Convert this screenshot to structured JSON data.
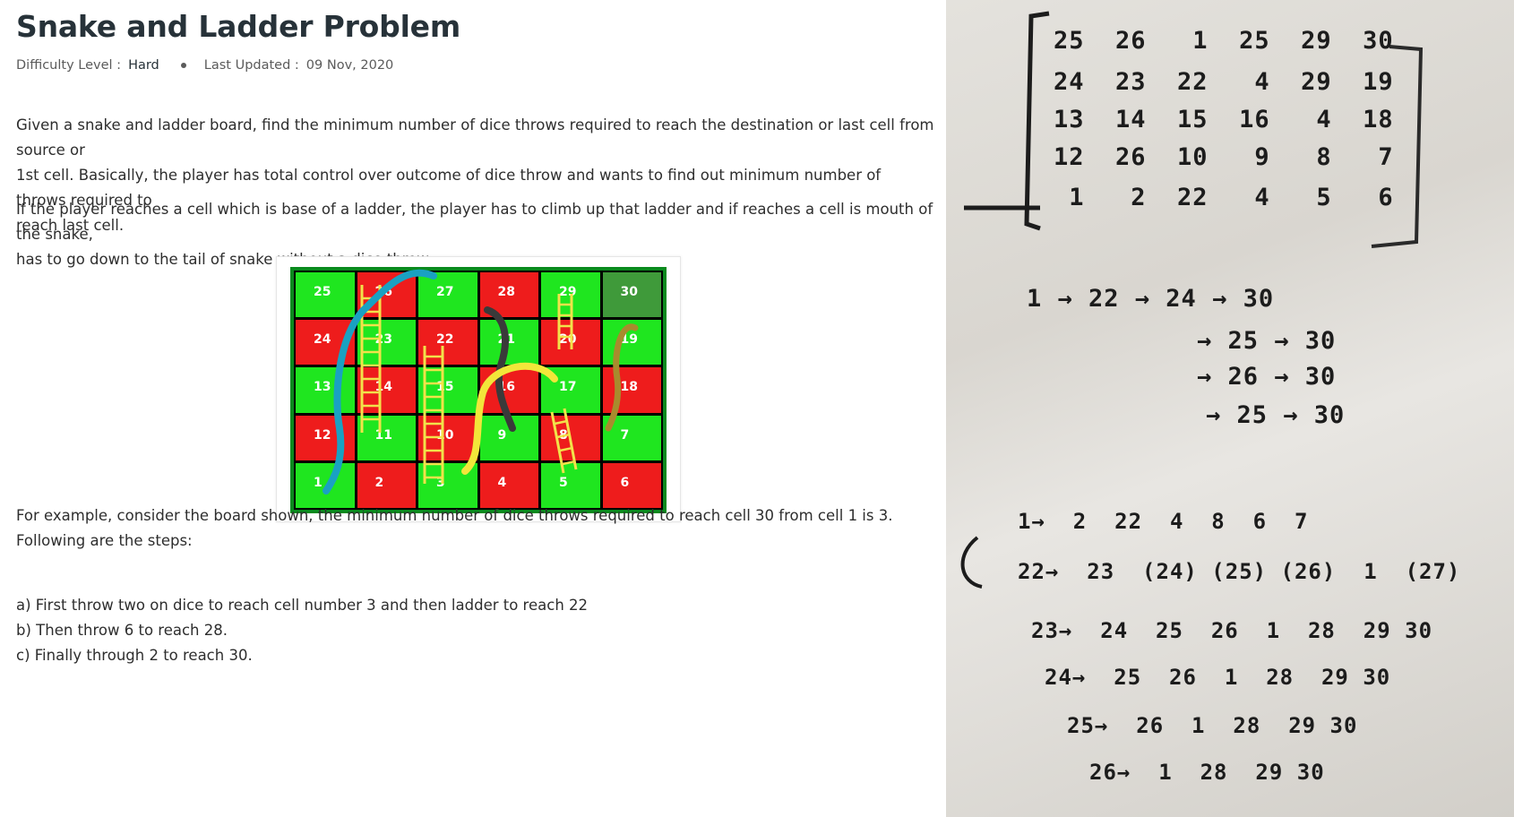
{
  "article": {
    "title": "Snake and Ladder Problem",
    "difficulty_label": "Difficulty Level :",
    "difficulty_value": "Hard",
    "updated_label": "Last Updated :",
    "updated_value": "09 Nov, 2020",
    "para1_line1": "Given a snake and ladder board, find the minimum number of dice throws required to reach the destination or last cell from source or",
    "para1_line2": "1st cell. Basically, the player has total control over outcome of dice throw and wants to find out minimum number of throws required to",
    "para1_line3": "reach last cell.",
    "para2_line1": "If the player reaches a cell which is base of a ladder, the player has to climb up that ladder and if reaches a cell is mouth of the snake,",
    "para2_line2": "has to go down to the tail of snake without a dice throw.",
    "example_line1": "For example, consider the board shown, the minimum number of dice throws required to reach cell 30 from cell 1 is 3.",
    "example_line2": "Following are the steps:",
    "step_a": "a) First throw two on dice to reach cell number 3 and then ladder to reach 22",
    "step_b": "b) Then throw 6 to reach 28.",
    "step_c": "c) Finally through 2 to reach 30."
  },
  "board": {
    "cells": [
      [
        "25",
        "26",
        "27",
        "28",
        "29",
        "30"
      ],
      [
        "24",
        "23",
        "22",
        "21",
        "20",
        "19"
      ],
      [
        "13",
        "14",
        "15",
        "16",
        "17",
        "18"
      ],
      [
        "12",
        "11",
        "10",
        "9",
        "8",
        "7"
      ],
      [
        "1",
        "2",
        "3",
        "4",
        "5",
        "6"
      ]
    ],
    "colors": [
      [
        "g",
        "r",
        "g",
        "r",
        "g",
        "d"
      ],
      [
        "r",
        "g",
        "r",
        "g",
        "r",
        "g"
      ],
      [
        "g",
        "r",
        "g",
        "r",
        "g",
        "r"
      ],
      [
        "r",
        "g",
        "r",
        "g",
        "r",
        "g"
      ],
      [
        "g",
        "r",
        "g",
        "r",
        "g",
        "r"
      ]
    ]
  },
  "notes": {
    "matrix_rows": [
      "25  26   1  25  29  30",
      "24  23  22   4  29  19",
      "13  14  15  16   4  18",
      "12  26  10   9   8   7",
      " 1   2  22   4   5   6"
    ],
    "path_lines": [
      "1 → 22 → 24 → 30",
      "→ 25 → 30",
      "→ 26 → 30",
      "→ 25 → 30"
    ],
    "bfs_lines": [
      "1→  2  22  4  8  6  7",
      "22→  23  (24) (25) (26)  1  (27)",
      "23→  24  25  26  1  28  29 30",
      "24→  25  26  1  28  29 30",
      "25→  26  1  28  29 30",
      "26→  1  28  29 30"
    ]
  }
}
